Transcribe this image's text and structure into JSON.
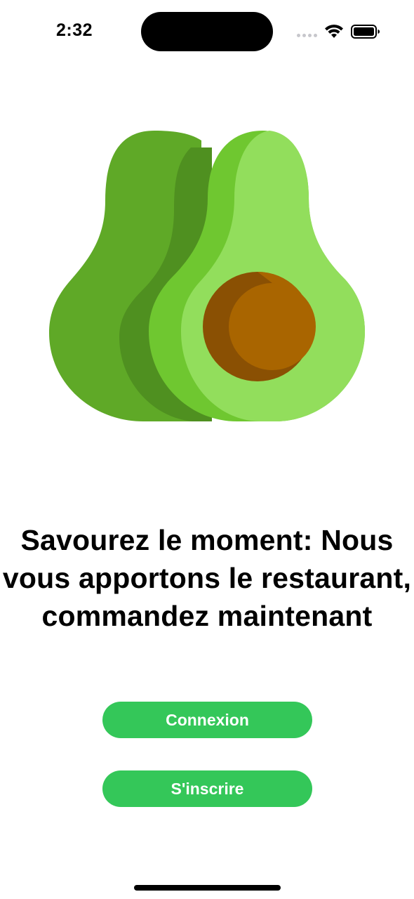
{
  "status_bar": {
    "time": "2:32",
    "icons": [
      "cellular-signal-icon",
      "wifi-icon",
      "battery-icon"
    ]
  },
  "hero": {
    "icon": "avocado-illustration",
    "colors": {
      "skin": "#5fa927",
      "skin_shadow": "#4f9020",
      "flesh_outer": "#6fc730",
      "flesh_inner": "#92de5c",
      "pit": "#a96500",
      "pit_shadow": "#8a5003"
    }
  },
  "headline": {
    "text": "Savourez le moment: Nous vous apportons le restaurant, commandez maintenant"
  },
  "actions": {
    "login_label": "Connexion",
    "signup_label": "S'inscrire",
    "accent_color": "#34c759"
  }
}
